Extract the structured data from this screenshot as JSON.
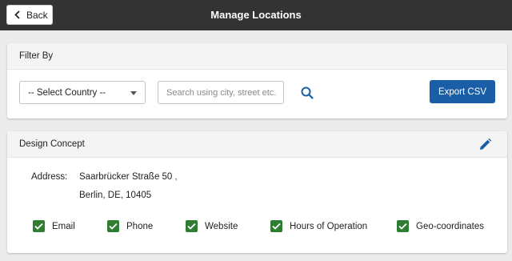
{
  "header": {
    "back_label": "Back",
    "title": "Manage Locations"
  },
  "filter": {
    "title": "Filter By",
    "country_select_value": "-- Select Country --",
    "search_placeholder": "Search using city, street etc.",
    "export_label": "Export CSV"
  },
  "location": {
    "name": "Design Concept",
    "address_label": "Address:",
    "address_line1": "Saarbrücker Straße 50",
    "address_line1_suffix": ",",
    "address_line2": "Berlin, DE, 10405",
    "checks": [
      {
        "label": "Email",
        "checked": true
      },
      {
        "label": "Phone",
        "checked": true
      },
      {
        "label": "Website",
        "checked": true
      },
      {
        "label": "Hours of Operation",
        "checked": true
      },
      {
        "label": "Geo-coordinates",
        "checked": true
      }
    ]
  },
  "colors": {
    "topbar": "#333333",
    "primary": "#1b5ea8",
    "check_green": "#2e7d32"
  }
}
